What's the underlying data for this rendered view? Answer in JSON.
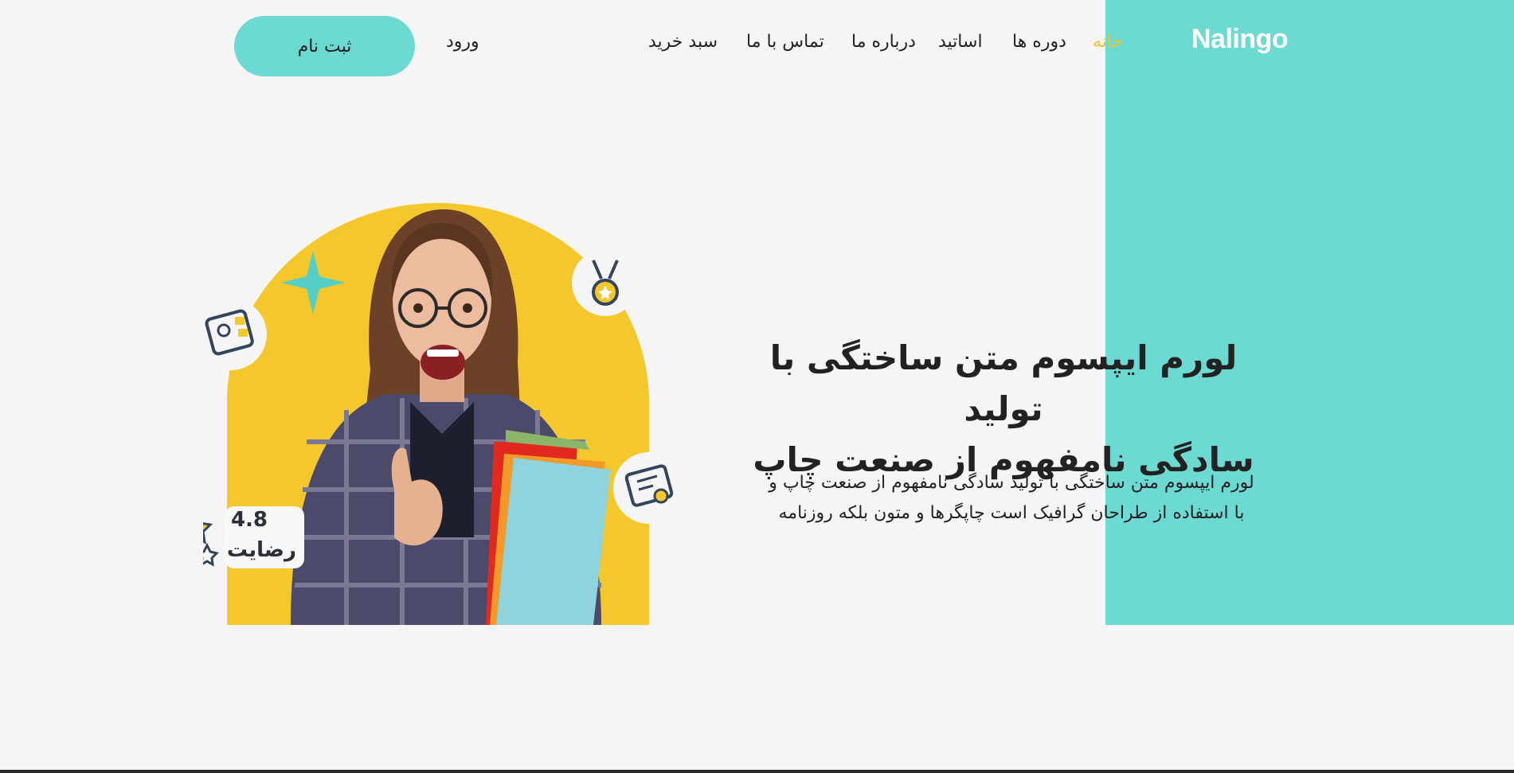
{
  "header": {
    "logo": "Nalingo",
    "nav": [
      "خانه",
      "دوره ها",
      "اساتید",
      "درباره ما",
      "تماس با ما",
      "سبد خرید"
    ],
    "login_label": "ورود",
    "signup_label": "ثبت نام"
  },
  "hero": {
    "title_line1": "لورم ایپسوم متن ساختگی با تولید",
    "title_line2": "سادگی نامفهوم از صنعت چاپ",
    "desc_line1": "لورم ایپسوم متن ساختگی با تولید سادگی نامفهوم از صنعت چاپ و",
    "desc_line2": "با استفاده از طراحان گرافیک است چاپگرها و متون بلکه روزنامه"
  },
  "rating": {
    "value": "4.8",
    "label": "رضایت"
  },
  "colors": {
    "accent_teal": "#6dd9d3",
    "accent_yellow": "#f2c12e",
    "background": "#f5f5f5"
  },
  "icons": [
    "sparkle-icon",
    "medal-icon",
    "profile-card-icon",
    "certificate-icon",
    "star-icon"
  ]
}
